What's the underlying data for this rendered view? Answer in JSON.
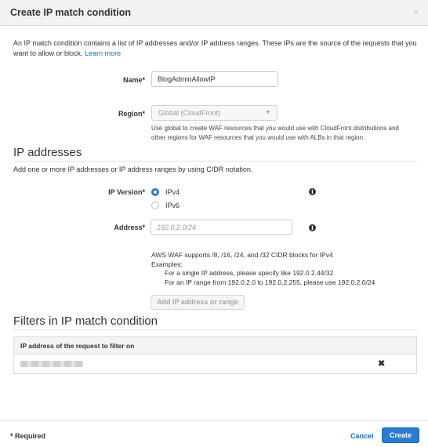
{
  "dialog": {
    "title": "Create IP match condition",
    "close_icon": "×"
  },
  "intro": {
    "text": "An IP match condition contains a list of IP addresses and/or IP address ranges. These IPs are the source of the requests that you want to allow or block.",
    "link": "Learn more"
  },
  "name_field": {
    "label": "Name*",
    "value": "BlogAdminAllowIP"
  },
  "region_field": {
    "label": "Region*",
    "value": "Global (CloudFront)",
    "help": "Use global to create WAF resources that you would use with CloudFront distributions and other regions for WAF resources that you would use with ALBs in that region."
  },
  "ip_addresses": {
    "title": "IP addresses",
    "description": "Add one or more IP addresses or IP address ranges by using CIDR notation.",
    "version_label": "IP Version*",
    "options": [
      "IPv4",
      "IPv6"
    ],
    "selected": "IPv4",
    "address_label": "Address*",
    "address_placeholder": "192.0.2.0/24",
    "cidr_note": "AWS WAF supports /8, /16, /24, and /32 CIDR blocks for IPv4",
    "examples_label": "Examples:",
    "example_single": "For a single IP address, please specify like 192.0.2.44/32",
    "example_range": "For an IP range from 192.0.2.0 to 192.0.2.255, please use 192.0.2.0/24",
    "add_button": "Add IP address or range"
  },
  "filters": {
    "title": "Filters in IP match condition",
    "column_header": "IP address of the request to filter on",
    "remove_icon": "✖"
  },
  "footer": {
    "required": "* Required",
    "cancel": "Cancel",
    "create": "Create"
  },
  "colors": {
    "accent": "#2a7cd3",
    "link": "#1a6bb8"
  }
}
